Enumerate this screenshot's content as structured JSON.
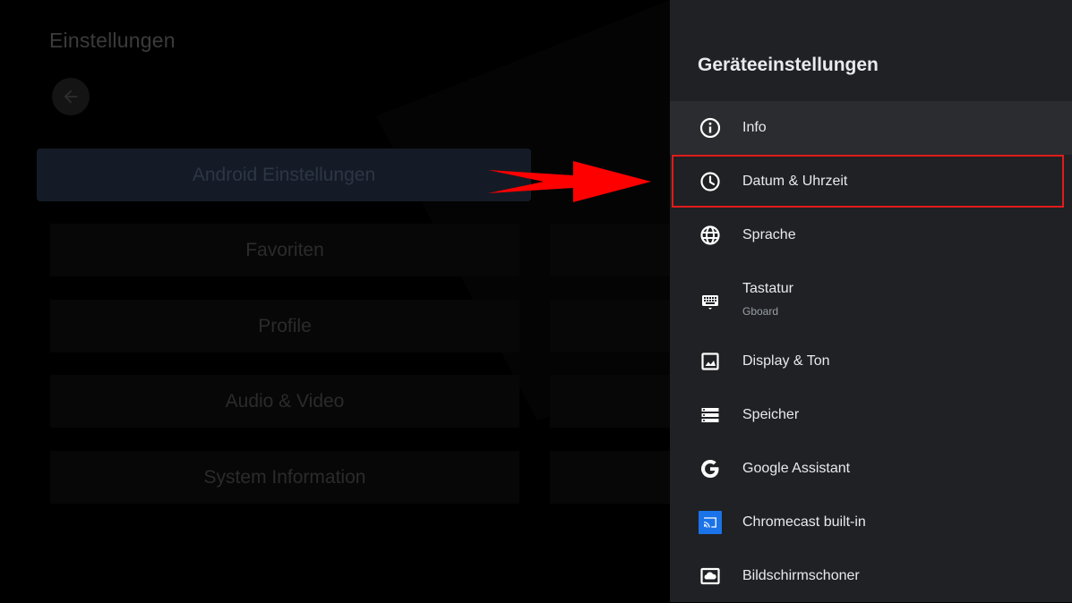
{
  "left_screen": {
    "title": "Einstellungen",
    "back_icon": "arrow-left-icon",
    "tiles": {
      "android": "Android Einstellungen",
      "favoriten": "Favoriten",
      "profile": "Profile",
      "audio_video": "Audio & Video",
      "system_information": "System Information"
    }
  },
  "panel": {
    "title": "Geräteeinstellungen",
    "items": {
      "info": {
        "label": "Info",
        "icon": "info-icon"
      },
      "datum": {
        "label": "Datum & Uhrzeit",
        "icon": "clock-icon"
      },
      "sprache": {
        "label": "Sprache",
        "icon": "globe-icon"
      },
      "tastatur": {
        "label": "Tastatur",
        "sublabel": "Gboard",
        "icon": "keyboard-icon"
      },
      "display": {
        "label": "Display & Ton",
        "icon": "image-icon"
      },
      "speicher": {
        "label": "Speicher",
        "icon": "storage-icon"
      },
      "assistant": {
        "label": "Google Assistant",
        "icon": "google-g-icon"
      },
      "chromecast": {
        "label": "Chromecast built-in",
        "icon": "cast-icon"
      },
      "bildschirmschoner": {
        "label": "Bildschirmschoner",
        "icon": "screensaver-icon"
      }
    }
  },
  "colors": {
    "panel_bg": "#202124",
    "annotation_red": "#e01b1b",
    "cast_blue": "#1a73e8"
  }
}
